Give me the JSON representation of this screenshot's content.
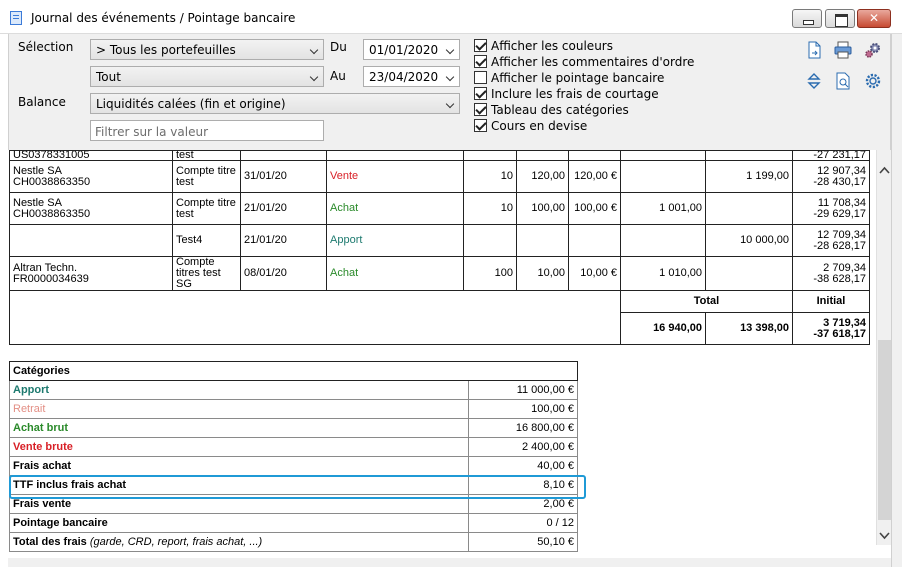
{
  "window": {
    "title": "Journal des événements / Pointage bancaire"
  },
  "filters": {
    "selection_label": "Sélection",
    "selection_value": "> Tous les portefeuilles",
    "type_value": "Tout",
    "balance_label": "Balance",
    "balance_value": "Liquidités calées (fin et origine)",
    "du_label": "Du",
    "du_value": "01/01/2020",
    "au_label": "Au",
    "au_value": "23/04/2020",
    "filter_placeholder": "Filtrer sur la valeur"
  },
  "options": [
    {
      "label": "Afficher les couleurs",
      "checked": true
    },
    {
      "label": "Afficher les commentaires d'ordre",
      "checked": true
    },
    {
      "label": "Afficher le pointage bancaire",
      "checked": false
    },
    {
      "label": "Inclure les frais de courtage",
      "checked": true
    },
    {
      "label": "Tableau des catégories",
      "checked": true
    },
    {
      "label": "Cours en devise",
      "checked": true
    }
  ],
  "toolbar_icons": [
    "export-document-icon",
    "print-icon",
    "settings-cogs-icon",
    "expand-collapse-icon",
    "preview-document-icon",
    "gear-icon"
  ],
  "rows": {
    "partial": {
      "name": "US0378331005",
      "account": "test",
      "col10": "-27 231,17"
    },
    "r1": {
      "name1": "Nestle SA",
      "name2": "CH0038863350",
      "account1": "Compte titre",
      "account2": "test",
      "date": "31/01/20",
      "op": "Vente",
      "qty": "10",
      "price": "120,00",
      "price_eur": "120,00 €",
      "c8": "",
      "c9": "1 199,00",
      "bal1": "12 907,34",
      "bal2": "-28 430,17"
    },
    "r2": {
      "name1": "Nestle SA",
      "name2": "CH0038863350",
      "account1": "Compte titre",
      "account2": "test",
      "date": "21/01/20",
      "op": "Achat",
      "qty": "10",
      "price": "100,00",
      "price_eur": "100,00 €",
      "c8": "1 001,00",
      "c9": "",
      "bal1": "11 708,34",
      "bal2": "-29 629,17"
    },
    "r3": {
      "account1": "Test4",
      "date": "21/01/20",
      "op": "Apport",
      "c9": "10 000,00",
      "bal1": "12 709,34",
      "bal2": "-28 628,17"
    },
    "r4": {
      "name1": "Altran Techn.",
      "name2": "FR0000034639",
      "account1": "Compte",
      "account2": "titres test SG",
      "date": "08/01/20",
      "op": "Achat",
      "qty": "100",
      "price": "10,00",
      "price_eur": "10,00 €",
      "c8": "1 010,00",
      "c9": "",
      "bal1": "2 709,34",
      "bal2": "-38 628,17"
    }
  },
  "totals": {
    "total_label": "Total",
    "initial_label": "Initial",
    "total_debit": "16 940,00",
    "total_credit": "13 398,00",
    "initial1": "3 719,34",
    "initial2": "-37 618,17"
  },
  "categories": {
    "header": "Catégories",
    "items": [
      {
        "label": "Apport",
        "value": "11 000,00 €"
      },
      {
        "label": "Retrait",
        "value": "100,00 €"
      },
      {
        "label": "Achat brut",
        "value": "16 800,00 €"
      },
      {
        "label": "Vente brute",
        "value": "2 400,00 €"
      },
      {
        "label": "Frais achat",
        "value": "40,00 €"
      },
      {
        "label": "TTF inclus frais achat",
        "value": "8,10 €"
      },
      {
        "label": "Frais vente",
        "value": "2,00 €"
      },
      {
        "label": "Pointage bancaire",
        "value": "0 / 12"
      },
      {
        "label": "Total des frais",
        "label_suffix": "(garde, CRD, report, frais achat, ...)",
        "value": "50,10 €"
      }
    ]
  }
}
